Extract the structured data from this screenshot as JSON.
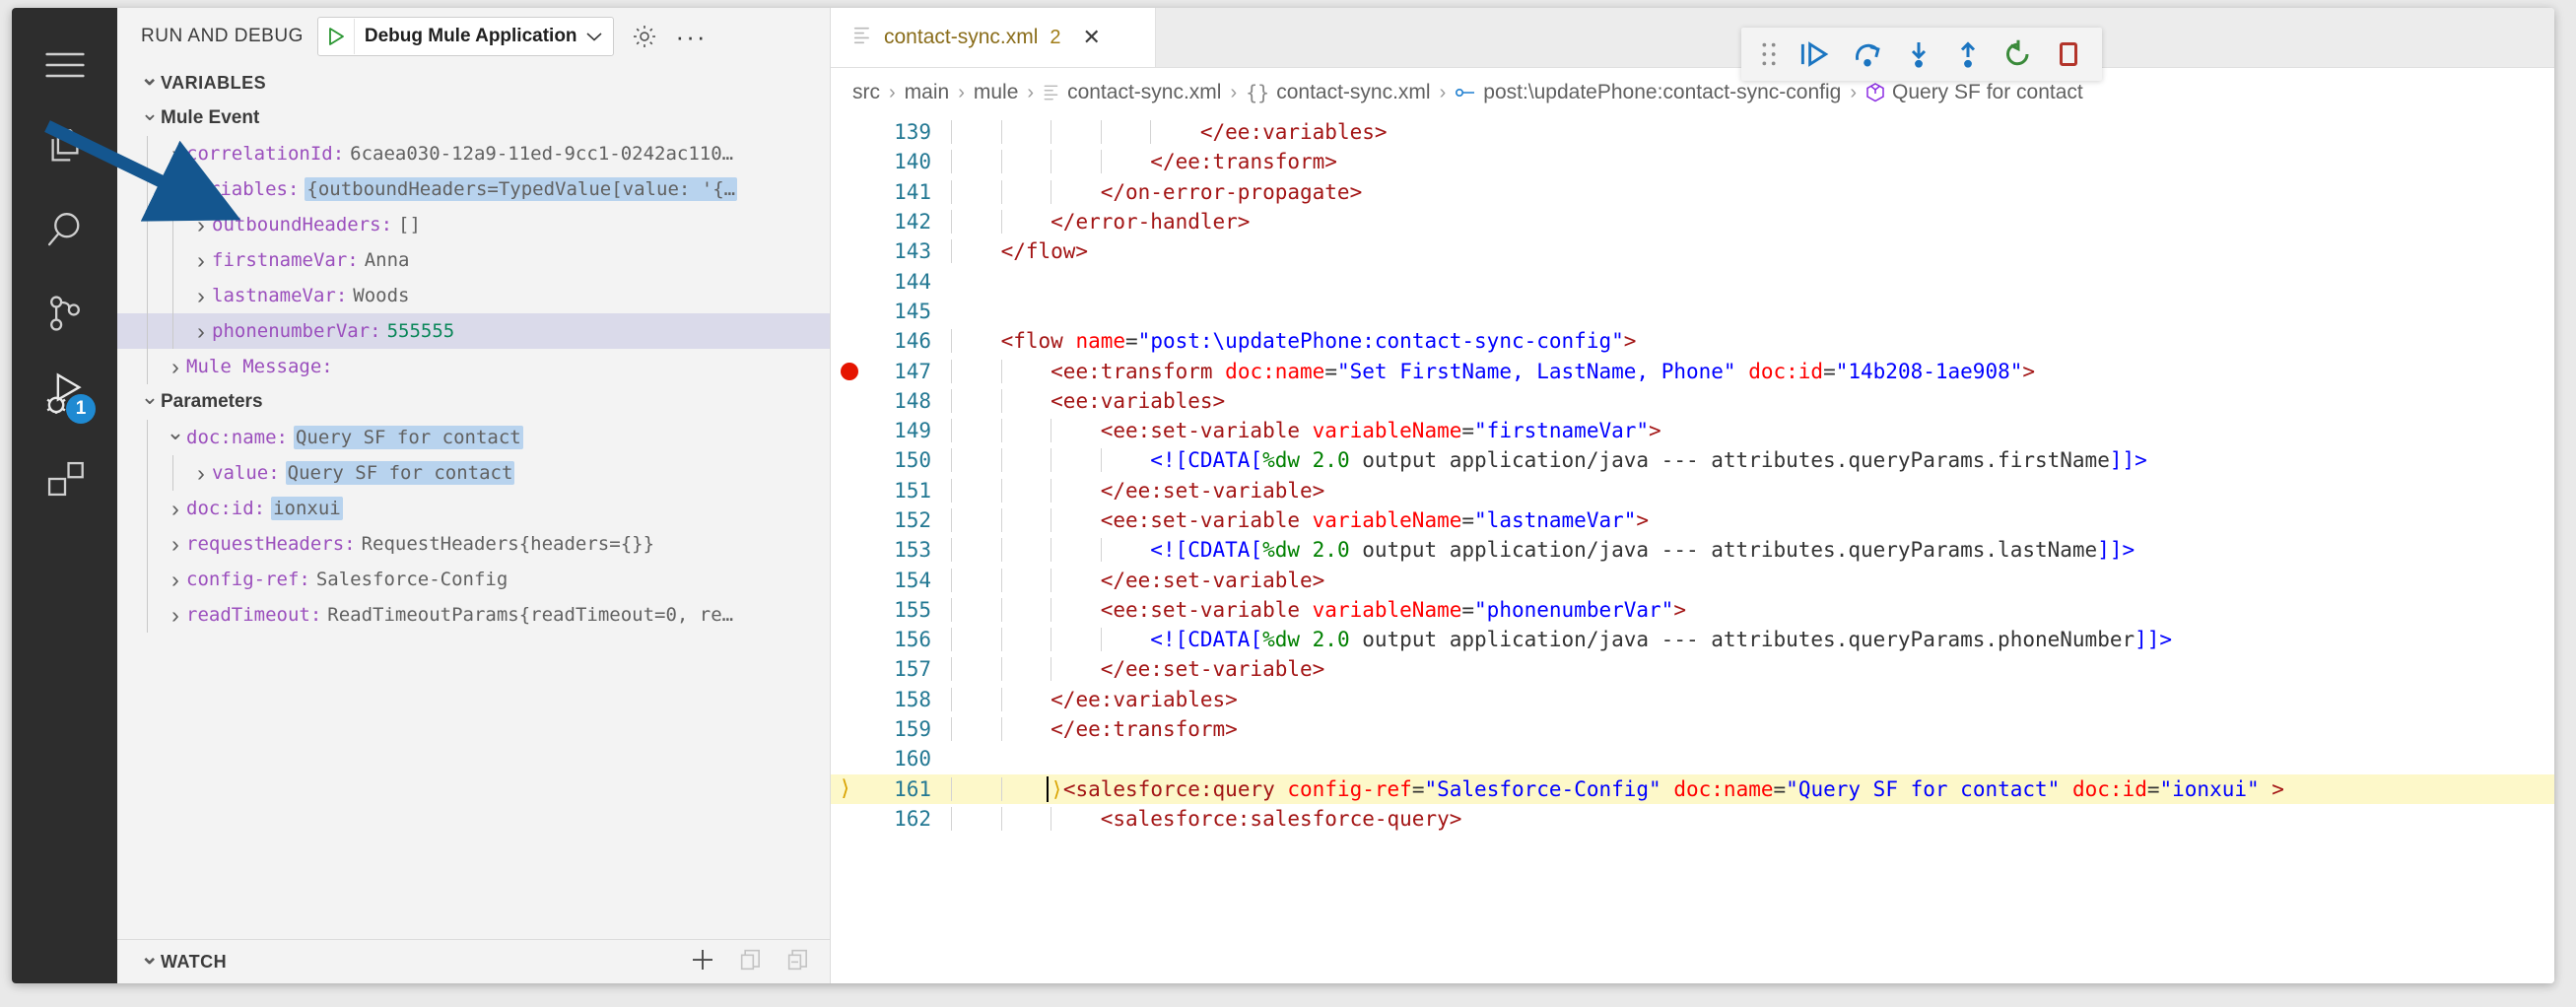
{
  "activity_bar": {
    "items": [
      {
        "name": "menu-icon",
        "label": "Menu"
      },
      {
        "name": "explorer-icon",
        "label": "Explorer"
      },
      {
        "name": "search-icon",
        "label": "Search"
      },
      {
        "name": "source-control-icon",
        "label": "Source Control"
      },
      {
        "name": "run-and-debug-icon",
        "label": "Run and Debug",
        "badge": "1"
      },
      {
        "name": "extensions-icon",
        "label": "Extensions"
      }
    ]
  },
  "sidebar": {
    "title": "RUN AND DEBUG",
    "launch_config": "Debug Mule Application",
    "gear_tooltip": "Open launch.json",
    "more_actions": "···",
    "sections": {
      "variables_label": "VARIABLES",
      "watch_label": "WATCH"
    },
    "tree": [
      {
        "indent": 1,
        "twisty": "down",
        "label": "Mule Event",
        "bold": true
      },
      {
        "indent": 2,
        "twisty": "right",
        "key": "correlationId:",
        "value": "6caea030-12a9-11ed-9cc1-0242ac110…"
      },
      {
        "indent": 2,
        "twisty": "down",
        "key": "Variables:",
        "value": "{outboundHeaders=TypedValue[value: '{…",
        "highlight": true
      },
      {
        "indent": 3,
        "twisty": "right",
        "key": "outboundHeaders:",
        "value": "[]"
      },
      {
        "indent": 3,
        "twisty": "right",
        "key": "firstnameVar:",
        "value": "Anna"
      },
      {
        "indent": 3,
        "twisty": "right",
        "key": "lastnameVar:",
        "value": "Woods"
      },
      {
        "indent": 3,
        "twisty": "right",
        "key": "phonenumberVar:",
        "value": "555555",
        "numeric": true,
        "selected": true
      },
      {
        "indent": 2,
        "twisty": "right",
        "key": "Mule Message:",
        "value": ""
      },
      {
        "indent": 1,
        "twisty": "down",
        "label": "Parameters",
        "bold": true
      },
      {
        "indent": 2,
        "twisty": "down",
        "key": "doc:name:",
        "value": "Query SF for contact",
        "highlight": true
      },
      {
        "indent": 3,
        "twisty": "right",
        "key": "value:",
        "value": "Query SF for contact",
        "highlight": true
      },
      {
        "indent": 2,
        "twisty": "right",
        "key": "doc:id:",
        "value": "ionxui",
        "highlight": true
      },
      {
        "indent": 2,
        "twisty": "right",
        "key": "requestHeaders:",
        "value": "RequestHeaders{headers={}}"
      },
      {
        "indent": 2,
        "twisty": "right",
        "key": "config-ref:",
        "value": "Salesforce-Config"
      },
      {
        "indent": 2,
        "twisty": "right",
        "key": "readTimeout:",
        "value": "ReadTimeoutParams{readTimeout=0, re…"
      }
    ],
    "watch_actions": [
      {
        "name": "add-expression-icon",
        "glyph": "+"
      },
      {
        "name": "collapse-all-icon",
        "glyph": "❐"
      },
      {
        "name": "remove-all-expressions-icon",
        "glyph": "❐"
      }
    ]
  },
  "debug_toolbar": {
    "buttons": [
      {
        "name": "drag-handle-icon",
        "label": "Drag"
      },
      {
        "name": "continue-icon",
        "label": "Continue"
      },
      {
        "name": "step-over-icon",
        "label": "Step Over"
      },
      {
        "name": "step-into-icon",
        "label": "Step Into"
      },
      {
        "name": "step-out-icon",
        "label": "Step Out"
      },
      {
        "name": "restart-icon",
        "label": "Restart"
      },
      {
        "name": "stop-icon",
        "label": "Stop"
      }
    ]
  },
  "editor": {
    "tab": {
      "filename": "contact-sync.xml",
      "count": "2",
      "close": "✕"
    },
    "breadcrumb": [
      {
        "label": "src"
      },
      {
        "label": "main"
      },
      {
        "label": "mule"
      },
      {
        "label": "contact-sync.xml",
        "icon": "xml-file-icon"
      },
      {
        "label": "contact-sync.xml",
        "icon": "braces-icon"
      },
      {
        "label": "post:\\updatePhone:contact-sync-config",
        "icon": "symbol-key-icon"
      },
      {
        "label": "Query SF for contact",
        "icon": "symbol-object-icon"
      }
    ],
    "first_line": 139,
    "lines": [
      {
        "n": 139,
        "indent": 5,
        "tokens": [
          {
            "t": "tag",
            "v": "</ee:variables>"
          }
        ]
      },
      {
        "n": 140,
        "indent": 4,
        "tokens": [
          {
            "t": "tag",
            "v": "</ee:transform>"
          }
        ]
      },
      {
        "n": 141,
        "indent": 3,
        "tokens": [
          {
            "t": "tag",
            "v": "</on-error-propagate>"
          }
        ]
      },
      {
        "n": 142,
        "indent": 2,
        "tokens": [
          {
            "t": "tag",
            "v": "</error-handler>"
          }
        ]
      },
      {
        "n": 143,
        "indent": 1,
        "tokens": [
          {
            "t": "tag",
            "v": "</flow>"
          }
        ]
      },
      {
        "n": 144,
        "indent": 0,
        "tokens": []
      },
      {
        "n": 145,
        "indent": 0,
        "tokens": []
      },
      {
        "n": 146,
        "indent": 1,
        "tokens": [
          {
            "t": "tag",
            "v": "<flow "
          },
          {
            "t": "attr",
            "v": "name"
          },
          {
            "t": "eq",
            "v": "="
          },
          {
            "t": "str",
            "v": "\"post:\\updatePhone:contact-sync-config\""
          },
          {
            "t": "tag",
            "v": ">"
          }
        ]
      },
      {
        "n": 147,
        "indent": 2,
        "breakpoint": true,
        "tokens": [
          {
            "t": "tag",
            "v": "<ee:transform "
          },
          {
            "t": "attr",
            "v": "doc:name"
          },
          {
            "t": "eq",
            "v": "="
          },
          {
            "t": "str",
            "v": "\"Set FirstName, LastName, Phone\""
          },
          {
            "t": "txt",
            "v": " "
          },
          {
            "t": "attr",
            "v": "doc:id"
          },
          {
            "t": "eq",
            "v": "="
          },
          {
            "t": "str",
            "v": "\"14b208-1ae908\""
          },
          {
            "t": "tag",
            "v": ">"
          }
        ]
      },
      {
        "n": 148,
        "indent": 2,
        "tokens": [
          {
            "t": "tag",
            "v": "<ee:variables>"
          }
        ]
      },
      {
        "n": 149,
        "indent": 3,
        "tokens": [
          {
            "t": "tag",
            "v": "<ee:set-variable "
          },
          {
            "t": "attr",
            "v": "variableName"
          },
          {
            "t": "eq",
            "v": "="
          },
          {
            "t": "str",
            "v": "\"firstnameVar\""
          },
          {
            "t": "tag",
            "v": ">"
          }
        ]
      },
      {
        "n": 150,
        "indent": 4,
        "tokens": [
          {
            "t": "cdata",
            "v": "<![CDATA["
          },
          {
            "t": "kw",
            "v": "%dw 2.0"
          },
          {
            "t": "txt",
            "v": " output application/java --- attributes.queryParams.firstName"
          },
          {
            "t": "cdata",
            "v": "]]>"
          }
        ]
      },
      {
        "n": 151,
        "indent": 3,
        "tokens": [
          {
            "t": "tag",
            "v": "</ee:set-variable>"
          }
        ]
      },
      {
        "n": 152,
        "indent": 3,
        "tokens": [
          {
            "t": "tag",
            "v": "<ee:set-variable "
          },
          {
            "t": "attr",
            "v": "variableName"
          },
          {
            "t": "eq",
            "v": "="
          },
          {
            "t": "str",
            "v": "\"lastnameVar\""
          },
          {
            "t": "tag",
            "v": ">"
          }
        ]
      },
      {
        "n": 153,
        "indent": 4,
        "tokens": [
          {
            "t": "cdata",
            "v": "<![CDATA["
          },
          {
            "t": "kw",
            "v": "%dw 2.0"
          },
          {
            "t": "txt",
            "v": " output application/java --- attributes.queryParams.lastName"
          },
          {
            "t": "cdata",
            "v": "]]>"
          }
        ]
      },
      {
        "n": 154,
        "indent": 3,
        "tokens": [
          {
            "t": "tag",
            "v": "</ee:set-variable>"
          }
        ]
      },
      {
        "n": 155,
        "indent": 3,
        "tokens": [
          {
            "t": "tag",
            "v": "<ee:set-variable "
          },
          {
            "t": "attr",
            "v": "variableName"
          },
          {
            "t": "eq",
            "v": "="
          },
          {
            "t": "str",
            "v": "\"phonenumberVar\""
          },
          {
            "t": "tag",
            "v": ">"
          }
        ]
      },
      {
        "n": 156,
        "indent": 4,
        "tokens": [
          {
            "t": "cdata",
            "v": "<![CDATA["
          },
          {
            "t": "kw",
            "v": "%dw 2.0"
          },
          {
            "t": "txt",
            "v": " output application/java --- attributes.queryParams.phoneNumber"
          },
          {
            "t": "cdata",
            "v": "]]>"
          }
        ]
      },
      {
        "n": 157,
        "indent": 3,
        "tokens": [
          {
            "t": "tag",
            "v": "</ee:set-variable>"
          }
        ]
      },
      {
        "n": 158,
        "indent": 2,
        "tokens": [
          {
            "t": "tag",
            "v": "</ee:variables>"
          }
        ]
      },
      {
        "n": 159,
        "indent": 2,
        "tokens": [
          {
            "t": "tag",
            "v": "</ee:transform>"
          }
        ]
      },
      {
        "n": 160,
        "indent": 0,
        "tokens": []
      },
      {
        "n": 161,
        "indent": 2,
        "highlighted": true,
        "fold": true,
        "cursor": true,
        "tokens": [
          {
            "t": "tag",
            "v": "<salesforce:query "
          },
          {
            "t": "attr",
            "v": "config-ref"
          },
          {
            "t": "eq",
            "v": "="
          },
          {
            "t": "str",
            "v": "\"Salesforce-Config\""
          },
          {
            "t": "txt",
            "v": " "
          },
          {
            "t": "attr",
            "v": "doc:name"
          },
          {
            "t": "eq",
            "v": "="
          },
          {
            "t": "str",
            "v": "\"Query SF for contact\""
          },
          {
            "t": "txt",
            "v": " "
          },
          {
            "t": "attr",
            "v": "doc:id"
          },
          {
            "t": "eq",
            "v": "="
          },
          {
            "t": "str",
            "v": "\"ionxui\""
          },
          {
            "t": "tag",
            "v": " >"
          }
        ]
      },
      {
        "n": 162,
        "indent": 3,
        "tokens": [
          {
            "t": "tag",
            "v": "<salesforce:salesforce-query>"
          }
        ]
      }
    ]
  },
  "annotation": {
    "arrow_color": "#14568f",
    "points_to": "firstnameVar: Anna"
  },
  "colors": {
    "accent_blue": "#1f8ad2",
    "breakpoint_red": "#e51400",
    "highlight_yellow": "#fdf8c9",
    "selection_blue": "#b8d3ee",
    "tree_selected": "#dadaea"
  }
}
